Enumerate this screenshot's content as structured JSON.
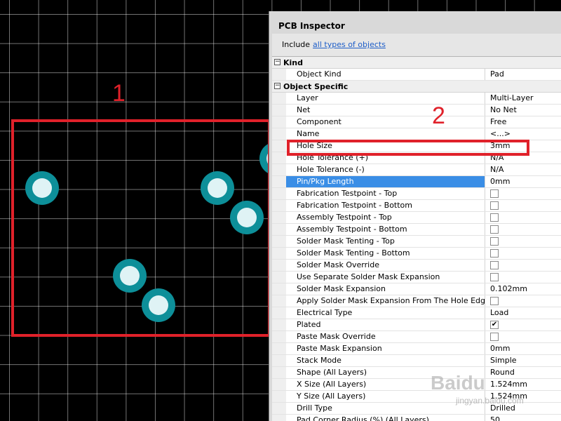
{
  "panel": {
    "title": "PCB Inspector",
    "include_prefix": "Include",
    "include_link": "all types of objects"
  },
  "sections": {
    "kind": "Kind",
    "object_specific": "Object Specific"
  },
  "kind_rows": [
    {
      "name": "Object Kind",
      "value": "Pad"
    }
  ],
  "props": [
    {
      "name": "Layer",
      "value": "Multi-Layer"
    },
    {
      "name": "Net",
      "value": "No Net"
    },
    {
      "name": "Component",
      "value": "Free"
    },
    {
      "name": "Name",
      "value": "<...>"
    },
    {
      "name": "Hole Size",
      "value": "3mm"
    },
    {
      "name": "Hole Tolerance (+)",
      "value": "N/A"
    },
    {
      "name": "Hole Tolerance (-)",
      "value": "N/A"
    },
    {
      "name": "Pin/Pkg Length",
      "value": "0mm",
      "selected": true
    },
    {
      "name": "Fabrication Testpoint - Top",
      "checkbox": true,
      "checked": false
    },
    {
      "name": "Fabrication Testpoint - Bottom",
      "checkbox": true,
      "checked": false
    },
    {
      "name": "Assembly Testpoint - Top",
      "checkbox": true,
      "checked": false
    },
    {
      "name": "Assembly Testpoint - Bottom",
      "checkbox": true,
      "checked": false
    },
    {
      "name": "Solder Mask Tenting - Top",
      "checkbox": true,
      "checked": false
    },
    {
      "name": "Solder Mask Tenting - Bottom",
      "checkbox": true,
      "checked": false
    },
    {
      "name": "Solder Mask Override",
      "checkbox": true,
      "checked": false
    },
    {
      "name": "Use Separate Solder Mask Expansion",
      "checkbox": true,
      "checked": false
    },
    {
      "name": "Solder Mask Expansion",
      "value": "0.102mm"
    },
    {
      "name": "Apply Solder Mask Expansion From The Hole Edge",
      "checkbox": true,
      "checked": false
    },
    {
      "name": "Electrical Type",
      "value": "Load"
    },
    {
      "name": "Plated",
      "checkbox": true,
      "checked": true
    },
    {
      "name": "Paste Mask Override",
      "checkbox": true,
      "checked": false
    },
    {
      "name": "Paste Mask Expansion",
      "value": "0mm"
    },
    {
      "name": "Stack Mode",
      "value": "Simple"
    },
    {
      "name": "Shape (All Layers)",
      "value": "Round"
    },
    {
      "name": "X Size (All Layers)",
      "value": "1.524mm"
    },
    {
      "name": "Y Size (All Layers)",
      "value": "1.524mm"
    },
    {
      "name": "Drill Type",
      "value": "Drilled"
    },
    {
      "name": "Pad Corner Radius (%) (All Layers)",
      "value": "50"
    }
  ],
  "annotations": {
    "label_1": "1",
    "label_2": "2"
  },
  "watermark": {
    "logo": "Baidu",
    "sub": "jingyan.baidu.com"
  },
  "colors": {
    "pad_ring": "#0d8f99",
    "pad_hole": "#dff3f5",
    "annotation_red": "#e0212a",
    "selection_blue": "#3a8ee6",
    "link_blue": "#1e5ec8"
  }
}
